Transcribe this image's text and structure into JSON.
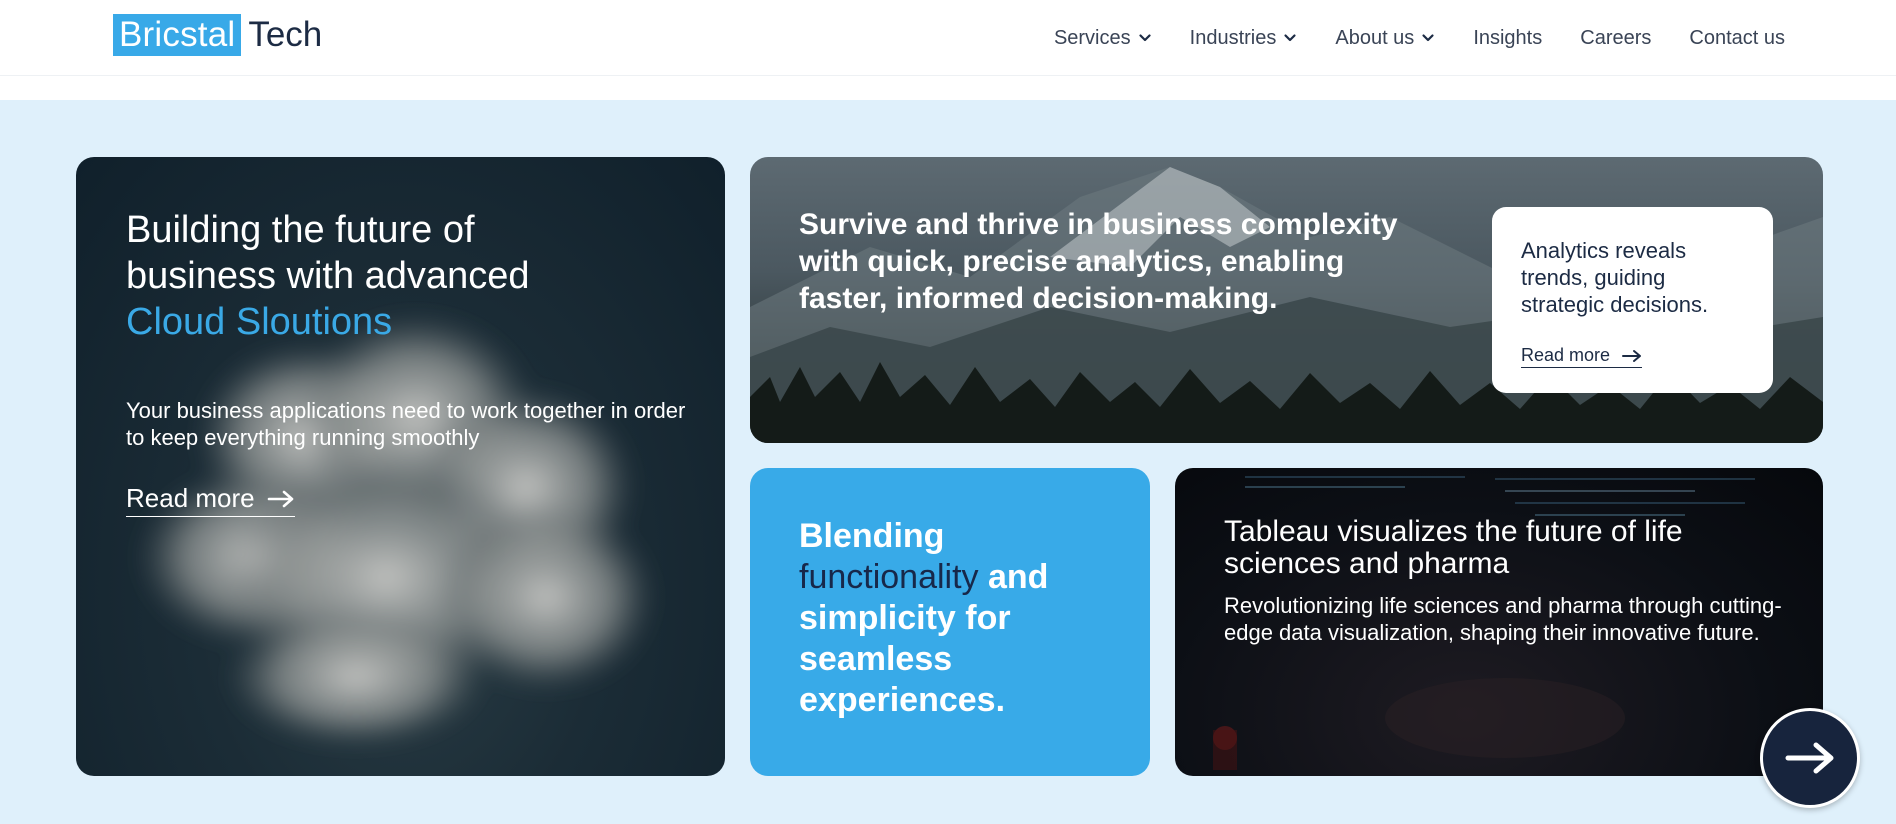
{
  "brand": {
    "logo_highlight": "Bricstal",
    "logo_rest": "Tech",
    "accent_color": "#38a9e8",
    "dark_color": "#17243d"
  },
  "nav": {
    "items": [
      {
        "label": "Services",
        "has_dropdown": true
      },
      {
        "label": "Industries",
        "has_dropdown": true
      },
      {
        "label": "About us",
        "has_dropdown": true
      },
      {
        "label": "Insights",
        "has_dropdown": false
      },
      {
        "label": "Careers",
        "has_dropdown": false
      },
      {
        "label": "Contact us",
        "has_dropdown": false
      }
    ]
  },
  "cards": {
    "cloud": {
      "title_line1": "Building the future of",
      "title_line2": "business with advanced",
      "title_highlight": "Cloud Sloutions",
      "subtitle": "Your business applications need to work together in order to keep everything running smoothly",
      "read_more": "Read more"
    },
    "analytics": {
      "title": "Survive and thrive in business complexity with quick, precise analytics, enabling faster, informed decision-making.",
      "inner_text": "Analytics reveals trends, guiding strategic decisions.",
      "read_more": "Read more"
    },
    "blending": {
      "part1": "Blending",
      "highlight": "functionality",
      "part2": "and simplicity for seamless experiences."
    },
    "tableau": {
      "title": "Tableau visualizes the future of life sciences and pharma",
      "subtitle": "Revolutionizing life sciences and pharma through cutting-edge data visualization, shaping their innovative future."
    }
  },
  "icons": {
    "chevron": "chevron-down-icon",
    "arrow": "arrow-right-icon"
  }
}
